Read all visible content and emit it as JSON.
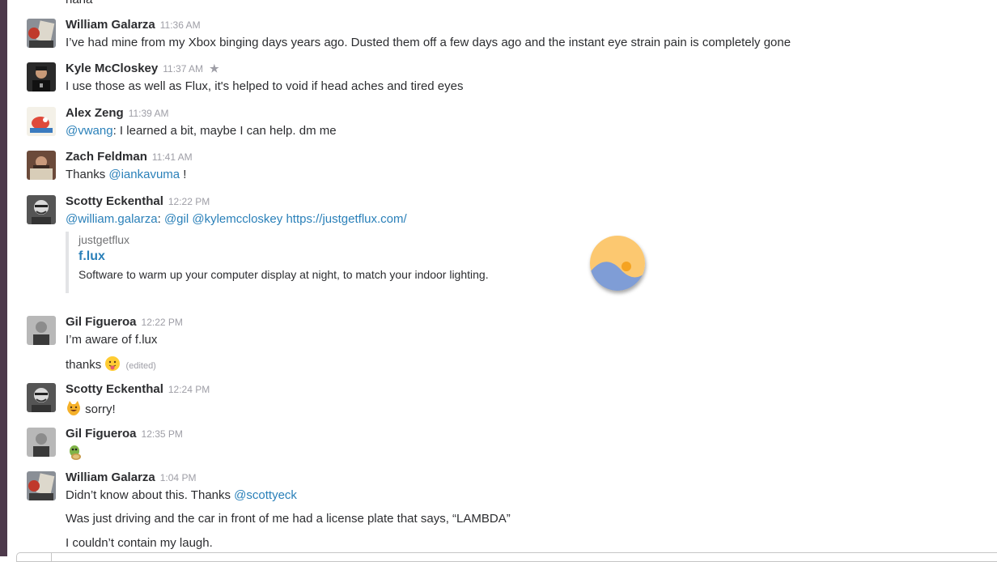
{
  "messages": {
    "prev": {
      "text": "haha"
    },
    "m1": {
      "author": "William Galarza",
      "time": "11:36 AM",
      "text": "I’ve had mine from my Xbox binging days years ago. Dusted them off a few days ago and the instant eye strain pain is completely gone"
    },
    "m2": {
      "author": "Kyle McCloskey",
      "time": "11:37 AM",
      "text": "I use those as well as Flux, it's helped to void if head aches and tired eyes"
    },
    "m3": {
      "author": "Alex Zeng",
      "time": "11:39 AM",
      "mention": "@vwang",
      "text": ": I learned a bit, maybe I can help.  dm me"
    },
    "m4": {
      "author": "Zach Feldman",
      "time": "11:41 AM",
      "prefix": "Thanks ",
      "mention": "@iankavuma",
      "suffix": " !"
    },
    "m5": {
      "author": "Scotty Eckenthal",
      "time": "12:22 PM",
      "mention1": "@william.galarza",
      "sep": ": ",
      "mention2": "@gil",
      "mention3": "@kylemccloskey",
      "url": "https://justgetflux.com/",
      "attachment": {
        "service": "justgetflux",
        "title": "f.lux",
        "description": "Software to warm up your computer display at night, to match your indoor lighting."
      }
    },
    "m6": {
      "author": "Gil Figueroa",
      "time": "12:22 PM",
      "text": "I’m aware of f.lux",
      "text2": "thanks",
      "edited": "(edited)"
    },
    "m7": {
      "author": "Scotty Eckenthal",
      "time": "12:24 PM",
      "text": "sorry!"
    },
    "m8": {
      "author": "Gil Figueroa",
      "time": "12:35 PM"
    },
    "m9": {
      "author": "William Galarza",
      "time": "1:04 PM",
      "prefix": "Didn’t know about this. Thanks ",
      "mention": "@scottyeck",
      "text2": "Was just driving and the car in front of me had a license plate that says, “LAMBDA”",
      "text3": "I couldn’t contain my laugh."
    }
  },
  "colors": {
    "sidebar": "#4d394b",
    "link": "#2a80b9",
    "timestamp": "#9e9ea6"
  },
  "icons": [
    "star-icon",
    "tongue-emoji-icon",
    "smiley-cat-emoji-icon",
    "turtle-emoji-icon",
    "flux-logo-icon"
  ]
}
